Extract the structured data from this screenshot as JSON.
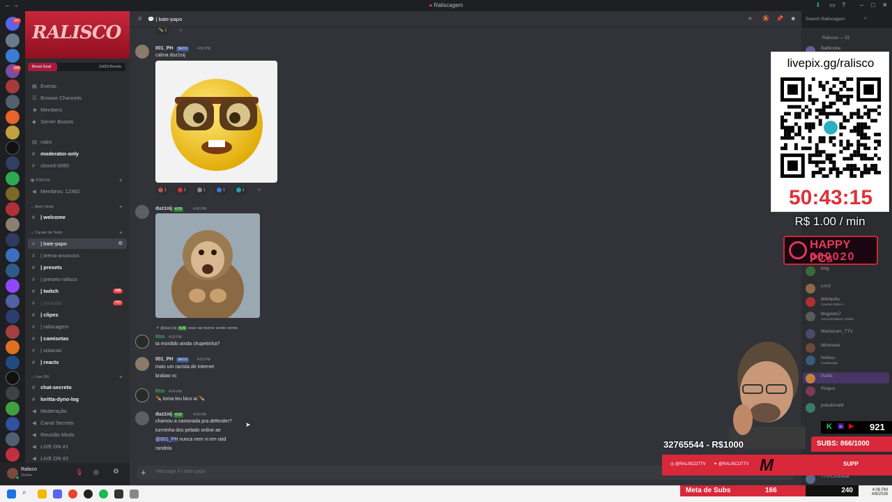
{
  "window": {
    "title": "Raliscagem"
  },
  "guild": {
    "name": "Raliscagem",
    "banner_text": "RALISCO",
    "boost_goal_label": "Boost Goal",
    "boost_progress": "10/33 Boosts",
    "boost_progress_fraction": 0.3
  },
  "server_badges": [
    "347",
    "448"
  ],
  "nav_items": [
    {
      "label": "Events",
      "icon": "calendar-icon"
    },
    {
      "label": "Browse Channels",
      "icon": "browse-icon"
    },
    {
      "label": "Members",
      "icon": "members-icon"
    },
    {
      "label": "Server Boosts",
      "icon": "boost-icon"
    }
  ],
  "channels_top": [
    {
      "label": "rules",
      "style": "normal"
    },
    {
      "label": "moderator-only",
      "style": "bold"
    },
    {
      "label": "closed-0090",
      "style": "normal"
    }
  ],
  "categories": {
    "status": "STATUS",
    "welcome": "Bem Vindo",
    "text": "Canais de Texto",
    "live": "Live ON"
  },
  "status_channel": "Membros: 12382",
  "welcome_channel": "| welcome",
  "text_channels": [
    {
      "label": "| bate-papo",
      "style": "sel",
      "badge": ""
    },
    {
      "label": "| arena-anuncios",
      "style": "normal",
      "badge": ""
    },
    {
      "label": "| presets",
      "style": "bold",
      "badge": ""
    },
    {
      "label": "| presets-ralisco",
      "style": "normal",
      "badge": ""
    },
    {
      "label": "| twitch",
      "style": "bold",
      "badge": "149"
    },
    {
      "label": "| youtube",
      "style": "dim",
      "badge": "299"
    },
    {
      "label": "| clipes",
      "style": "bold",
      "badge": ""
    },
    {
      "label": "| raliscagem",
      "style": "normal",
      "badge": ""
    },
    {
      "label": "| camisetas",
      "style": "bold",
      "badge": ""
    },
    {
      "label": "| votacao",
      "style": "normal",
      "badge": ""
    },
    {
      "label": "| reacts",
      "style": "bold",
      "badge": ""
    }
  ],
  "live_channels": [
    {
      "label": "chat-secreto",
      "style": "bold"
    },
    {
      "label": "loritta-dyno-log",
      "style": "bold"
    },
    {
      "label": "Moderação",
      "style": "normal"
    },
    {
      "label": "Canal Secreto",
      "style": "normal"
    },
    {
      "label": "Reunião Mods",
      "style": "normal"
    },
    {
      "label": "LIVE ON #1",
      "style": "normal"
    },
    {
      "label": "LIVE ON #2",
      "style": "normal"
    }
  ],
  "user": {
    "name": "Ralisco",
    "status": "Online"
  },
  "header": {
    "channel": "| bate-papo",
    "search_placeholder": "Search Raliscagem"
  },
  "messages": [
    {
      "author": "001_PH",
      "tag": "SECO",
      "time": "4:01 PM",
      "lines": [
        "calma duz1nij"
      ],
      "color": "#f2f3f5"
    },
    {
      "author": "duz1nij",
      "tag": "4:20",
      "time": "4:02 PM",
      "lines": [],
      "color": "#f2f3f5"
    },
    {
      "reply": "@duz1nij",
      "reply_tag": "4:20",
      "reply_text": "esse vai morrer sendo verme"
    },
    {
      "author": "Rtm",
      "tag": "",
      "time": "4:03 PM",
      "lines": [
        "ta mordido ainda chupetinha?"
      ],
      "color": "#3ba55c"
    },
    {
      "author": "001_PH",
      "tag": "SECO",
      "time": "4:03 PM",
      "lines": [
        "mais um racista de internet",
        "brabao vc"
      ],
      "color": "#f2f3f5"
    },
    {
      "author": "Rtm",
      "tag": "",
      "time": "4:04 PM",
      "lines": [
        "toma teu bico ai"
      ],
      "color": "#3ba55c"
    },
    {
      "author": "duz1nij",
      "tag": "4:20",
      "time": "4:04 PM",
      "lines": [
        "chamou a namorada pra defender?",
        "turminha dos pelado online ae",
        "@001_PH nunca nem vi em raid",
        "randola"
      ],
      "color": "#f2f3f5"
    }
  ],
  "reactions": [
    "1",
    "1",
    "1",
    "1",
    "1"
  ],
  "top_reaction": "1",
  "input_placeholder": "Message # | bate-papo",
  "member_group": "Raliscos — 33",
  "members": [
    {
      "name": "Balbinotw",
      "sub": ""
    },
    {
      "name": "kNg",
      "sub": ""
    },
    {
      "name": "Lnz3",
      "sub": ""
    },
    {
      "name": "M4t4p4to",
      "sub": "Counter-Strike 2"
    },
    {
      "name": "Magneto7",
      "sub": "Arena Breakout: Infinite"
    },
    {
      "name": "Mantovani_TTV",
      "sub": ""
    },
    {
      "name": "Mininovei",
      "sub": ""
    },
    {
      "name": "Nofaxu",
      "sub": "Cuwabunga"
    },
    {
      "name": "Patife",
      "sub": ""
    },
    {
      "name": "Pirajuu",
      "sub": ""
    },
    {
      "name": "putudonald",
      "sub": ""
    },
    {
      "name": "TTV/Churebal",
      "sub": ""
    }
  ],
  "member_badges": {
    "kng": "RTC",
    "patife": "AURA",
    "pirajuu": "TFT"
  },
  "stream_overlay": {
    "livepix_url": "livepix.gg/ralisco",
    "timer": "50:43:15",
    "rate": "R$ 1.00 / min",
    "happy_line1": "HAPPY PCs",
    "happy_line2": "000020",
    "viewers": "921",
    "counter": "32765544 - R$1000",
    "subs": "SUBS: 866/1000",
    "social_ig": "@RALISCOTTV",
    "social_tw": "@RALISCOTTV",
    "supp": "SUPP",
    "meta_label": "Meta de Subs",
    "meta_value": "166",
    "meta_total": "240"
  },
  "taskbar": {
    "time": "4:06 PM",
    "date": "4/8/2026"
  },
  "colors": {
    "accent": "#5865f2",
    "brand_red": "#d8283a",
    "online": "#23a55a"
  }
}
